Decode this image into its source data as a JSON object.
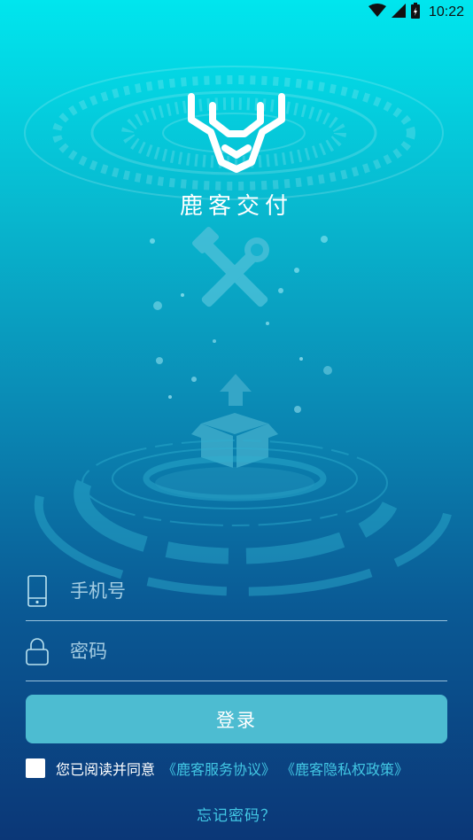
{
  "status_bar": {
    "time": "10:22",
    "icons": [
      "wifi-icon",
      "signal-icon",
      "battery-icon"
    ]
  },
  "app": {
    "name": "鹿客交付",
    "logo": "deer-antler-logo"
  },
  "illustration": {
    "icons": [
      "tools-icon",
      "box-upload-icon"
    ]
  },
  "form": {
    "phone": {
      "placeholder": "手机号",
      "value": "",
      "icon": "phone-icon"
    },
    "password": {
      "placeholder": "密码",
      "value": "",
      "icon": "lock-icon"
    },
    "login_label": "登录"
  },
  "agreement": {
    "checked": false,
    "text": "您已阅读并同意",
    "service_link": "《鹿客服务协议》",
    "privacy_link": "《鹿客隐私权政策》"
  },
  "forgot_password": "忘记密码？",
  "colors": {
    "gradient_top": "#00e6ee",
    "gradient_bottom": "#0b3777",
    "button": "#4dbcd1",
    "link": "#42c7e4"
  }
}
